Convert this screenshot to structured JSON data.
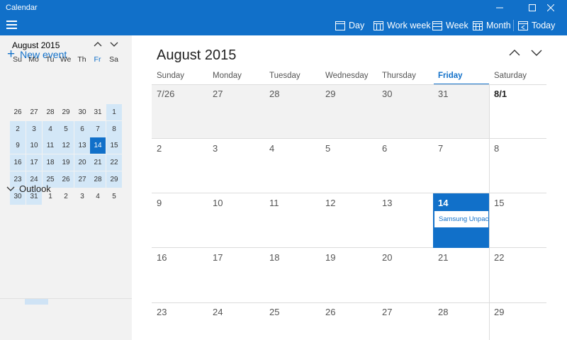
{
  "app": {
    "title": "Calendar"
  },
  "window": {
    "minimize": "—",
    "maximize": "☐",
    "close": "✕"
  },
  "toolbar": {
    "views": [
      {
        "label": "Day",
        "icon": "day-view-icon"
      },
      {
        "label": "Work week",
        "icon": "work-week-view-icon"
      },
      {
        "label": "Week",
        "icon": "week-view-icon"
      },
      {
        "label": "Month",
        "icon": "month-view-icon"
      },
      {
        "label": "Today",
        "icon": "today-icon"
      }
    ]
  },
  "sidebar": {
    "new_event": "New event",
    "mini_calendar": {
      "month_label": "August 2015",
      "days_of_week": [
        "Su",
        "Mo",
        "Tu",
        "We",
        "Th",
        "Fr",
        "Sa"
      ],
      "today_column": 5,
      "weeks": [
        [
          "26",
          "27",
          "28",
          "29",
          "30",
          "31",
          "1"
        ],
        [
          "2",
          "3",
          "4",
          "5",
          "6",
          "7",
          "8"
        ],
        [
          "9",
          "10",
          "11",
          "12",
          "13",
          "14",
          "15"
        ],
        [
          "16",
          "17",
          "18",
          "19",
          "20",
          "21",
          "22"
        ],
        [
          "23",
          "24",
          "25",
          "26",
          "27",
          "28",
          "29"
        ],
        [
          "30",
          "31",
          "1",
          "2",
          "3",
          "4",
          "5"
        ]
      ],
      "selected_day": "14"
    },
    "accounts": [
      {
        "label": "Outlook",
        "expanded": true
      }
    ]
  },
  "main": {
    "month_title": "August 2015",
    "days_of_week": [
      "Sunday",
      "Monday",
      "Tuesday",
      "Wednesday",
      "Thursday",
      "Friday",
      "Saturday"
    ],
    "today_column": 5,
    "weeks": [
      [
        "7/26",
        "27",
        "28",
        "29",
        "30",
        "31",
        "8/1"
      ],
      [
        "2",
        "3",
        "4",
        "5",
        "6",
        "7",
        "8"
      ],
      [
        "9",
        "10",
        "11",
        "12",
        "13",
        "14",
        "15"
      ],
      [
        "16",
        "17",
        "18",
        "19",
        "20",
        "21",
        "22"
      ],
      [
        "23",
        "24",
        "25",
        "26",
        "27",
        "28",
        "29"
      ]
    ],
    "events": [
      {
        "date": "14",
        "title": "Samsung Unpacked"
      }
    ]
  },
  "colors": {
    "accent": "#1170c9",
    "sidebar_bg": "#f2f2f2",
    "mini_month_bg": "#d3e7f7"
  }
}
